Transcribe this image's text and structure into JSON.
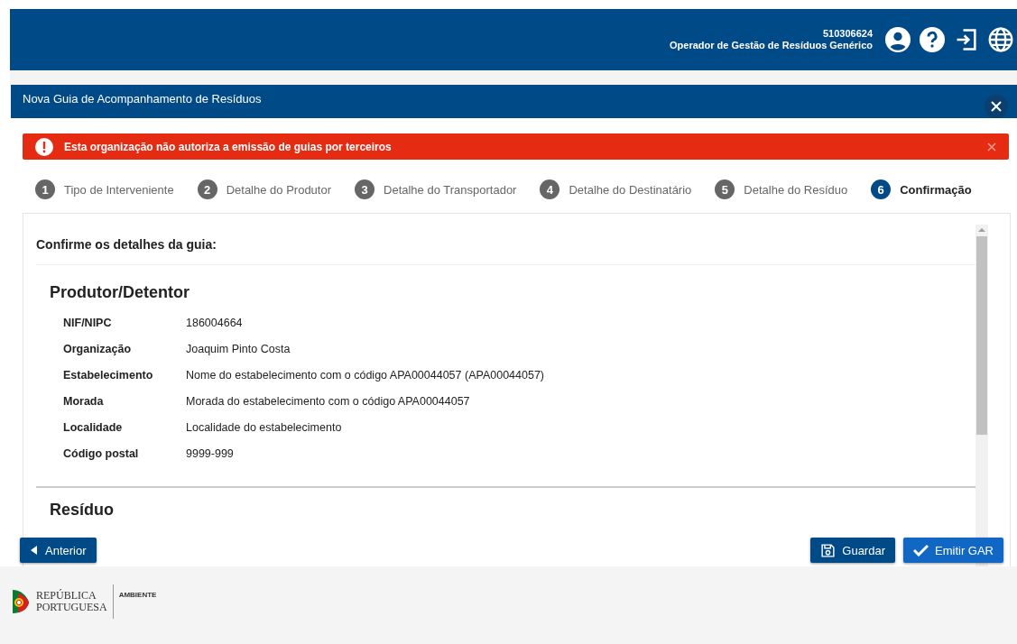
{
  "header": {
    "user_id": "510306624",
    "user_role": "Operador de Gestão de Resíduos Genérico"
  },
  "dialog": {
    "title": "Nova Guia de Acompanhamento de Resíduos"
  },
  "alert": {
    "message": "Esta organização não autoriza a emissão de guias por terceiros"
  },
  "steps": [
    {
      "number": "1",
      "label": "Tipo de Interveniente",
      "selected": false
    },
    {
      "number": "2",
      "label": "Detalhe do Produtor",
      "selected": false
    },
    {
      "number": "3",
      "label": "Detalhe do Transportador",
      "selected": false
    },
    {
      "number": "4",
      "label": "Detalhe do Destinatário",
      "selected": false
    },
    {
      "number": "5",
      "label": "Detalhe do Resíduo",
      "selected": false
    },
    {
      "number": "6",
      "label": "Confirmação",
      "selected": true
    }
  ],
  "content": {
    "heading": "Confirme os detalhes da guia:",
    "sections": [
      {
        "title": "Produtor/Detentor",
        "fields": [
          {
            "label": "NIF/NIPC",
            "value": "186004664"
          },
          {
            "label": "Organização",
            "value": "Joaquim Pinto Costa"
          },
          {
            "label": "Estabelecimento",
            "value": "Nome do estabelecimento com o código APA00044057 (APA00044057)"
          },
          {
            "label": "Morada",
            "value": "Morada do estabelecimento com o código APA00044057"
          },
          {
            "label": "Localidade",
            "value": "Localidade do estabelecimento"
          },
          {
            "label": "Código postal",
            "value": "9999-999"
          }
        ]
      },
      {
        "title": "Resíduo"
      }
    ]
  },
  "buttons": {
    "back": "Anterior",
    "save": "Guardar",
    "submit": "Emitir GAR"
  },
  "footer": {
    "logo_text": [
      "REPÚBLICA",
      "PORTUGUESA"
    ],
    "ministry": "AMBIENTE"
  }
}
